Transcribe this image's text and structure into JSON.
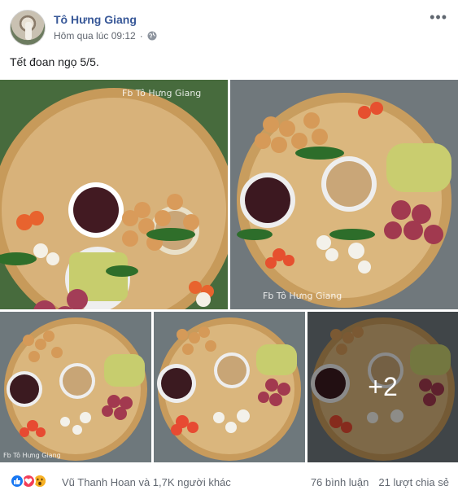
{
  "post": {
    "author": "Tô Hưng Giang",
    "timestamp": "Hôm qua lúc 09:12",
    "privacy_icon": "globe-icon",
    "more_icon": "more-options-icon",
    "caption": "Tết đoan ngọ 5/5."
  },
  "photos": {
    "watermark_1": "Fb Tô Hưng Giang",
    "watermark_2": "Fb Tô Hưng Giang",
    "watermark_3": "Fb Tô Hưng Giang",
    "more_count": "+2"
  },
  "footer": {
    "reaction_icons": [
      "like-icon",
      "love-icon",
      "wow-icon"
    ],
    "reactions_text": "Vũ Thanh Hoan và 1,7K người khác",
    "comments": "76 bình luận",
    "shares": "21 lượt chia sẻ"
  },
  "colors": {
    "link": "#385898",
    "secondary_text": "#616770",
    "like_blue": "#1877f2",
    "love_red": "#f33e58",
    "wow_yellow": "#f7b125"
  }
}
